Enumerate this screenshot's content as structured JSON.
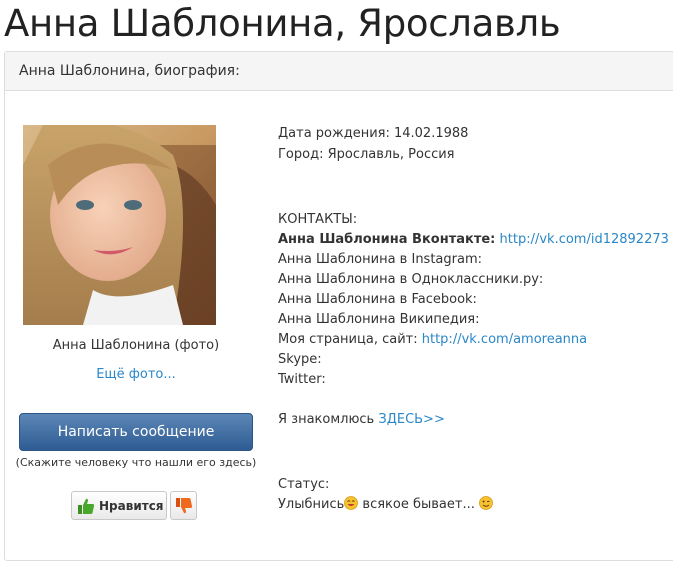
{
  "page": {
    "title": "Анна Шаблонина, Ярославль"
  },
  "panel": {
    "heading": "Анна Шаблонина, биография:"
  },
  "left": {
    "photo_caption": "Анна Шаблонина (фото)",
    "more_photos": "Ещё фото...",
    "message_button": "Написать сообщение",
    "message_hint": "(Скажите человеку что нашли его здесь)",
    "like_label": "Нравится"
  },
  "info": {
    "birth_date": "Дата рождения: 14.02.1988",
    "city": "Город: Ярославль, Россия",
    "contacts_heading": "КОНТАКТЫ:",
    "vk_label": "Анна Шаблонина Вконтакте:",
    "vk_url": "http://vk.com/id12892273",
    "instagram": "Анна Шаблонина в Instagram:",
    "odnoklassniki": "Анна Шаблонина в Одноклассники.ру:",
    "facebook": "Анна Шаблонина в Facebook:",
    "wikipedia": "Анна Шаблонина Википедия:",
    "site_label": "Моя страница, сайт:",
    "site_url": "http://vk.com/amoreanna",
    "skype": "Skype:",
    "twitter": "Twitter:",
    "dating_label": "Я знакомлюсь",
    "dating_link": "ЗДЕСЬ>>",
    "status_label": "Статус:",
    "status_part1": "Улыбнись",
    "status_part2": " всякое бывает...",
    "colors": {
      "link": "#2a87c8",
      "button": "#3a6aa3"
    }
  },
  "icons": [
    "thumbs-up-icon",
    "thumbs-down-icon",
    "smile-emoji-icon",
    "wink-emoji-icon"
  ]
}
